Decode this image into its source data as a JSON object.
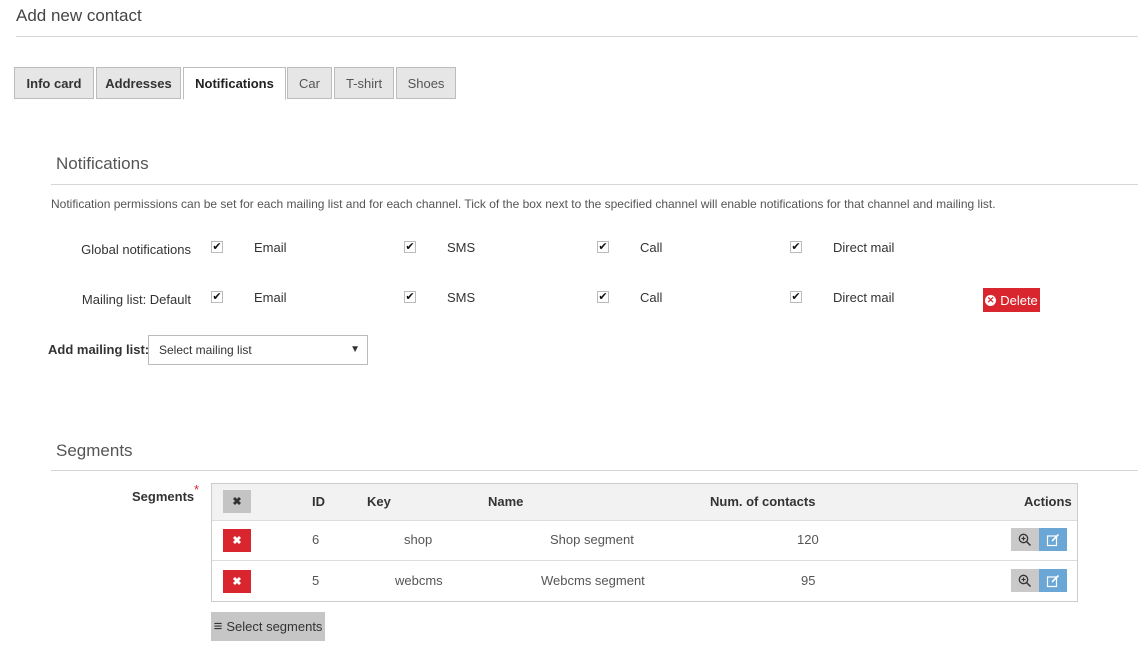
{
  "page": {
    "title": "Add new contact"
  },
  "tabs": [
    "Info card",
    "Addresses",
    "Notifications",
    "Car",
    "T-shirt",
    "Shoes"
  ],
  "notifications": {
    "title": "Notifications",
    "description": "Notification permissions can be set for each mailing list and for each channel. Tick of the box next to the specified channel will enable notifications for that channel and mailing list.",
    "channels": [
      "Email",
      "SMS",
      "Call",
      "Direct mail"
    ],
    "rows": [
      {
        "label": "Global notifications"
      },
      {
        "label": "Mailing list: Default",
        "delete_label": "Delete"
      }
    ],
    "checkmark": "✔",
    "add_label": "Add mailing list:",
    "select_placeholder": "Select mailing list",
    "select_arrow": "▼"
  },
  "segments": {
    "title": "Segments",
    "field_label": "Segments",
    "required_mark": "*",
    "headers": {
      "id": "ID",
      "key": "Key",
      "name": "Name",
      "contacts": "Num. of contacts",
      "actions": "Actions"
    },
    "rows": [
      {
        "id": "6",
        "key": "shop",
        "name": "Shop segment",
        "contacts": "120"
      },
      {
        "id": "5",
        "key": "webcms",
        "name": "Webcms segment",
        "contacts": "95"
      }
    ],
    "remove_glyph": "✖",
    "select_button": "Select segments",
    "menu_glyph": "≡"
  },
  "colors": {
    "danger": "#d9262e",
    "info": "#6aa7d6",
    "gray": "#c6c6c6"
  }
}
